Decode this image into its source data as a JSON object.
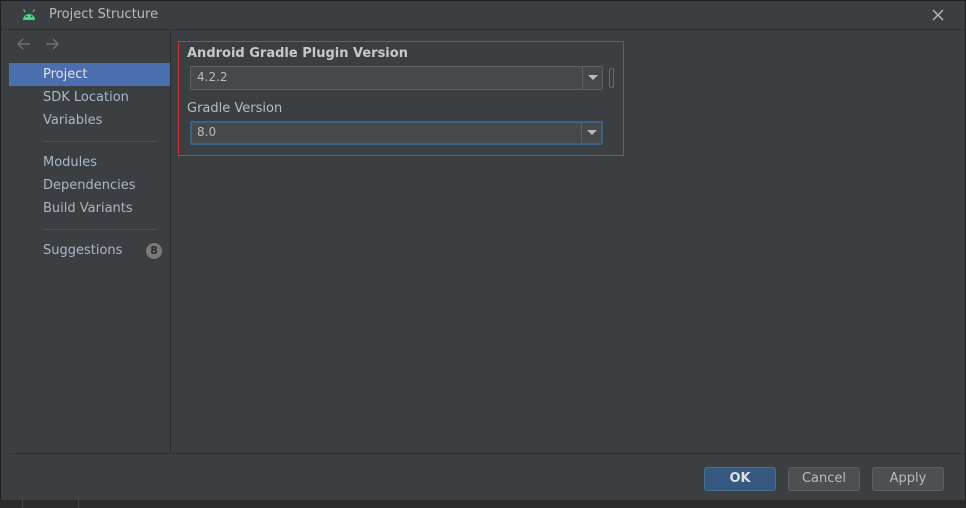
{
  "window": {
    "title": "Project Structure"
  },
  "icons": {
    "app": "android-icon",
    "close": "close-icon",
    "back": "arrow-left-icon",
    "forward": "arrow-right-icon",
    "dropdown": "chevron-down-icon"
  },
  "sidebar": {
    "items": [
      {
        "label": "Project",
        "selected": true
      },
      {
        "label": "SDK Location"
      },
      {
        "label": "Variables"
      },
      {
        "label": "Modules"
      },
      {
        "label": "Dependencies"
      },
      {
        "label": "Build Variants"
      },
      {
        "label": "Suggestions",
        "badge": "8"
      }
    ]
  },
  "main": {
    "agp": {
      "label": "Android Gradle Plugin Version",
      "value": "4.2.2"
    },
    "gradle": {
      "label": "Gradle Version",
      "value": "8.0"
    }
  },
  "buttons": {
    "ok": "OK",
    "cancel": "Cancel",
    "apply": "Apply"
  },
  "colors": {
    "accent": "#4b6eaf",
    "primary_button": "#365880",
    "highlight_border": "#c9353b",
    "android_green": "#3ddc84"
  }
}
